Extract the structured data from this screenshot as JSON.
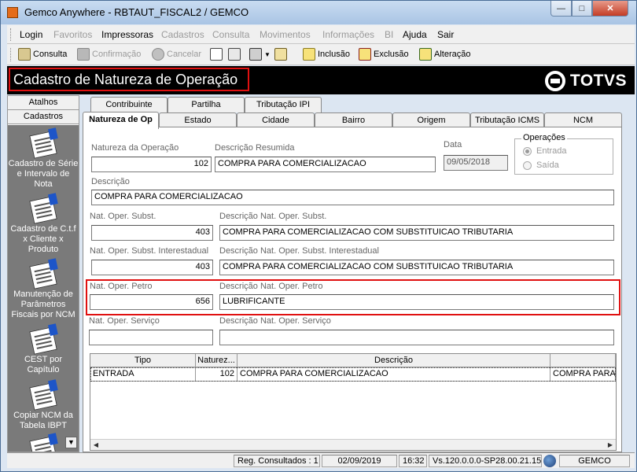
{
  "window": {
    "title": "Gemco Anywhere - RBTAUT_FISCAL2 / GEMCO",
    "btn_min": "—",
    "btn_max": "□",
    "btn_close": "✕"
  },
  "menu": [
    {
      "label": "Login",
      "enabled": true
    },
    {
      "label": "Favoritos",
      "enabled": false
    },
    {
      "label": "Impressoras",
      "enabled": true
    },
    {
      "label": "Cadastros",
      "enabled": false
    },
    {
      "label": "Consulta",
      "enabled": false
    },
    {
      "label": "Movimentos",
      "enabled": false
    },
    {
      "label": "Informações",
      "enabled": false
    },
    {
      "label": "BI",
      "enabled": false
    },
    {
      "label": "Ajuda",
      "enabled": true
    },
    {
      "label": "Sair",
      "enabled": true
    }
  ],
  "toolbar": {
    "consulta": "Consulta",
    "confirmacao": "Confirmação",
    "cancelar": "Cancelar",
    "inclusao": "Inclusão",
    "exclusao": "Exclusão",
    "alteracao": "Alteração"
  },
  "form_title": "Cadastro de Natureza de Operação",
  "logo_text": "TOTVS",
  "left_panel": {
    "atalhos": "Atalhos",
    "cadastros": "Cadastros",
    "items": [
      "Cadastro de Série e Intervalo de Nota",
      "Cadastro de C.t.f x Cliente x Produto",
      "Manutenção de Parâmetros Fiscais por NCM",
      "CEST por Capítulo",
      "Copiar NCM da Tabela IBPT"
    ],
    "scroll_down": "▼"
  },
  "tabs": {
    "row1": [
      "Contribuinte",
      "Partilha",
      "Tributação IPI"
    ],
    "row2": [
      "Natureza de Op",
      "Estado",
      "Cidade",
      "Bairro",
      "Origem",
      "Tributação ICMS",
      "NCM"
    ]
  },
  "form": {
    "natureza_label": "Natureza da Operação",
    "natureza_value": "102",
    "desc_resumida_label": "Descrição Resumida",
    "desc_resumida_value": "COMPRA PARA COMERCIALIZACAO",
    "data_label": "Data",
    "data_value": "09/05/2018",
    "operacoes_label": "Operações",
    "op_entrada": "Entrada",
    "op_saida": "Saída",
    "descricao_label": "Descrição",
    "descricao_value": "COMPRA PARA COMERCIALIZACAO",
    "subst_label": "Nat. Oper. Subst.",
    "subst_value": "403",
    "subst_desc_label": "Descrição Nat. Oper. Subst.",
    "subst_desc_value": "COMPRA PARA COMERCIALIZACAO COM SUBSTITUICAO TRIBUTARIA",
    "subst_inter_label": "Nat. Oper. Subst. Interestadual",
    "subst_inter_value": "403",
    "subst_inter_desc_label": "Descrição Nat. Oper. Subst. Interestadual",
    "subst_inter_desc_value": "COMPRA PARA COMERCIALIZACAO COM SUBSTITUICAO TRIBUTARIA",
    "petro_label": "Nat. Oper. Petro",
    "petro_value": "656",
    "petro_desc_label": "Descrição Nat. Oper. Petro",
    "petro_desc_value": "LUBRIFICANTE",
    "servico_label": "Nat. Oper. Serviço",
    "servico_value": "",
    "servico_desc_label": "Descrição Nat. Oper. Serviço",
    "servico_desc_value": ""
  },
  "grid": {
    "headers": [
      "Tipo",
      "Naturez...",
      "Descrição",
      ""
    ],
    "rows": [
      [
        "ENTRADA",
        "102",
        "COMPRA PARA COMERCIALIZACAO",
        "COMPRA PARA"
      ]
    ],
    "scroll_left": "◀",
    "scroll_right": "▶"
  },
  "status": {
    "reg": "Reg. Consultados : 1",
    "date": "02/09/2019",
    "time": "16:32",
    "version": "Vs.120.0.0.0-SP28.00.21.15",
    "user": "GEMCO"
  },
  "colors": {
    "title_band": "#000000",
    "highlight": "#e01010",
    "panel_bg": "#7a7a7a"
  }
}
